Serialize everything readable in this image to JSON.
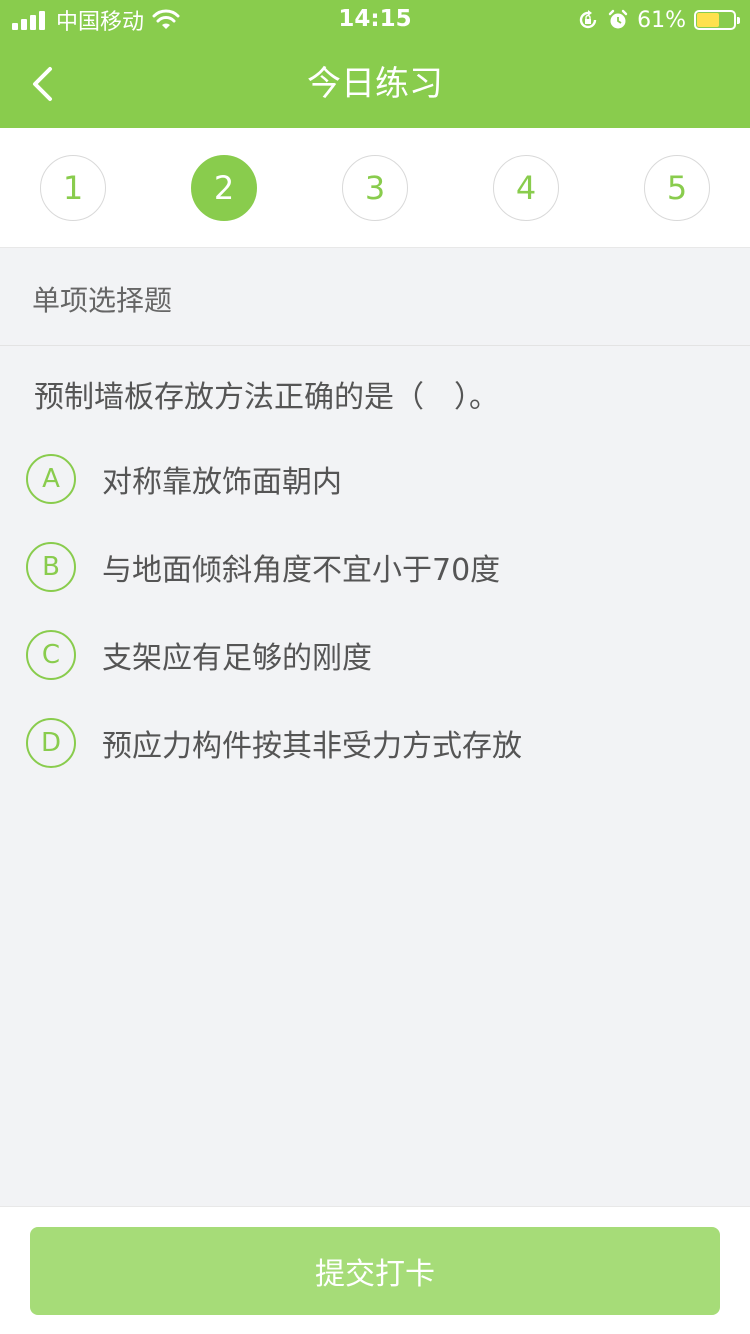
{
  "status_bar": {
    "carrier": "中国移动",
    "time": "14:15",
    "battery_percent": "61%",
    "battery_level": 0.61,
    "icons": [
      "signal-icon",
      "wifi-icon",
      "orientation-lock-icon",
      "alarm-icon",
      "battery-charging-icon"
    ]
  },
  "header": {
    "title": "今日练习",
    "back_icon": "chevron-left-icon",
    "background": "#89cc4d"
  },
  "question_numbers": {
    "items": [
      "1",
      "2",
      "3",
      "4",
      "5"
    ],
    "active_index": 1
  },
  "question": {
    "type": "单项选择题",
    "text": "预制墙板存放方法正确的是（　）。",
    "options": [
      {
        "letter": "A",
        "text": "对称靠放饰面朝内"
      },
      {
        "letter": "B",
        "text": "与地面倾斜角度不宜小于70度"
      },
      {
        "letter": "C",
        "text": "支架应有足够的刚度"
      },
      {
        "letter": "D",
        "text": "预应力构件按其非受力方式存放"
      }
    ]
  },
  "footer": {
    "submit_label": "提交打卡"
  },
  "colors": {
    "accent": "#89cc4d",
    "button_disabled": "#a6dc78",
    "page_background": "#f2f3f5"
  }
}
